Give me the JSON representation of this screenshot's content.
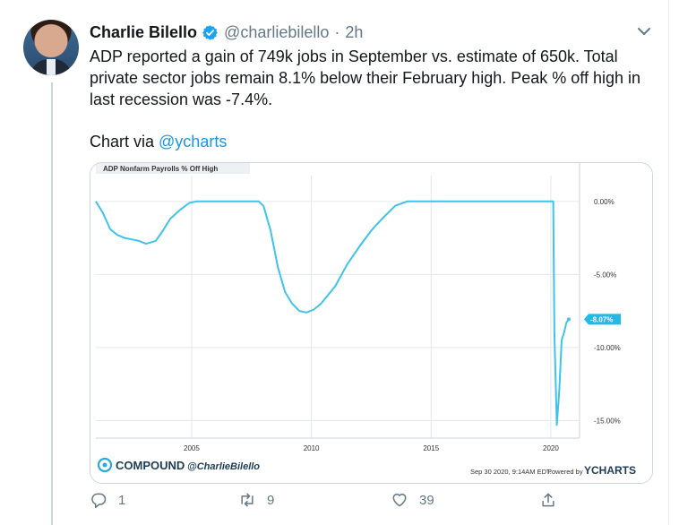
{
  "tweet": {
    "author_name": "Charlie Bilello",
    "handle": "@charliebilello",
    "separator": "·",
    "time": "2h",
    "text": "ADP reported a gain of 749k jobs in September vs. estimate of 650k. Total private sector jobs remain 8.1% below their February high. Peak % off high in last recession was -7.4%.",
    "via_prefix": "Chart via ",
    "via_mention": "@ycharts"
  },
  "actions": {
    "reply_count": "1",
    "retweet_count": "9",
    "like_count": "39"
  },
  "colors": {
    "accent": "#1b95e0",
    "line": "#3ec3ea",
    "muted": "#657786"
  },
  "icons": [
    "verified-badge-icon",
    "chevron-down-icon",
    "reply-icon",
    "retweet-icon",
    "like-icon",
    "share-icon"
  ],
  "chart": {
    "title": "ADP Nonfarm Payrolls % Off High",
    "logo_text": "COMPOUND",
    "logo_handle": "@CharlieBilello",
    "date_text": "Sep 30 2020, 9:14AM EDT.",
    "powered_by": "Powered by",
    "brand": "YCHARTS"
  },
  "chart_data": {
    "type": "line",
    "title": "ADP Nonfarm Payrolls % Off High",
    "xlabel": "",
    "ylabel": "",
    "x_ticks": [
      "2005",
      "2010",
      "2015",
      "2020"
    ],
    "y_ticks": [
      "0.00%",
      "-5.00%",
      "-10.00%",
      "-15.00%"
    ],
    "ylim": [
      -16.2,
      1.4
    ],
    "xlim": [
      2001.0,
      2021.2
    ],
    "grid": true,
    "last_value_label": "-8.07%",
    "series": [
      {
        "x": [
          2001.0,
          2001.3,
          2001.6,
          2001.9,
          2002.2,
          2002.5,
          2002.8,
          2003.1,
          2003.5,
          2003.8,
          2004.1,
          2004.5,
          2004.9,
          2005.2,
          2005.5,
          2007.0,
          2007.8,
          2008.0,
          2008.3,
          2008.6,
          2008.9,
          2009.2,
          2009.5,
          2009.8,
          2010.1,
          2010.4,
          2011.0,
          2011.5,
          2012.0,
          2012.5,
          2013.0,
          2013.5,
          2014.0,
          2019.8,
          2020.1,
          2020.15,
          2020.25,
          2020.35,
          2020.45,
          2020.55,
          2020.65,
          2020.75
        ],
        "y": [
          0.0,
          -0.8,
          -1.9,
          -2.3,
          -2.5,
          -2.6,
          -2.7,
          -2.9,
          -2.7,
          -2.0,
          -1.2,
          -0.6,
          -0.1,
          0.0,
          0.0,
          0.0,
          0.0,
          -0.3,
          -2.0,
          -4.5,
          -6.2,
          -7.0,
          -7.5,
          -7.6,
          -7.4,
          -7.0,
          -5.8,
          -4.3,
          -3.1,
          -2.0,
          -1.1,
          -0.3,
          0.0,
          0.0,
          0.0,
          -9.0,
          -15.3,
          -13.0,
          -9.5,
          -9.0,
          -8.3,
          -8.07
        ]
      }
    ]
  }
}
